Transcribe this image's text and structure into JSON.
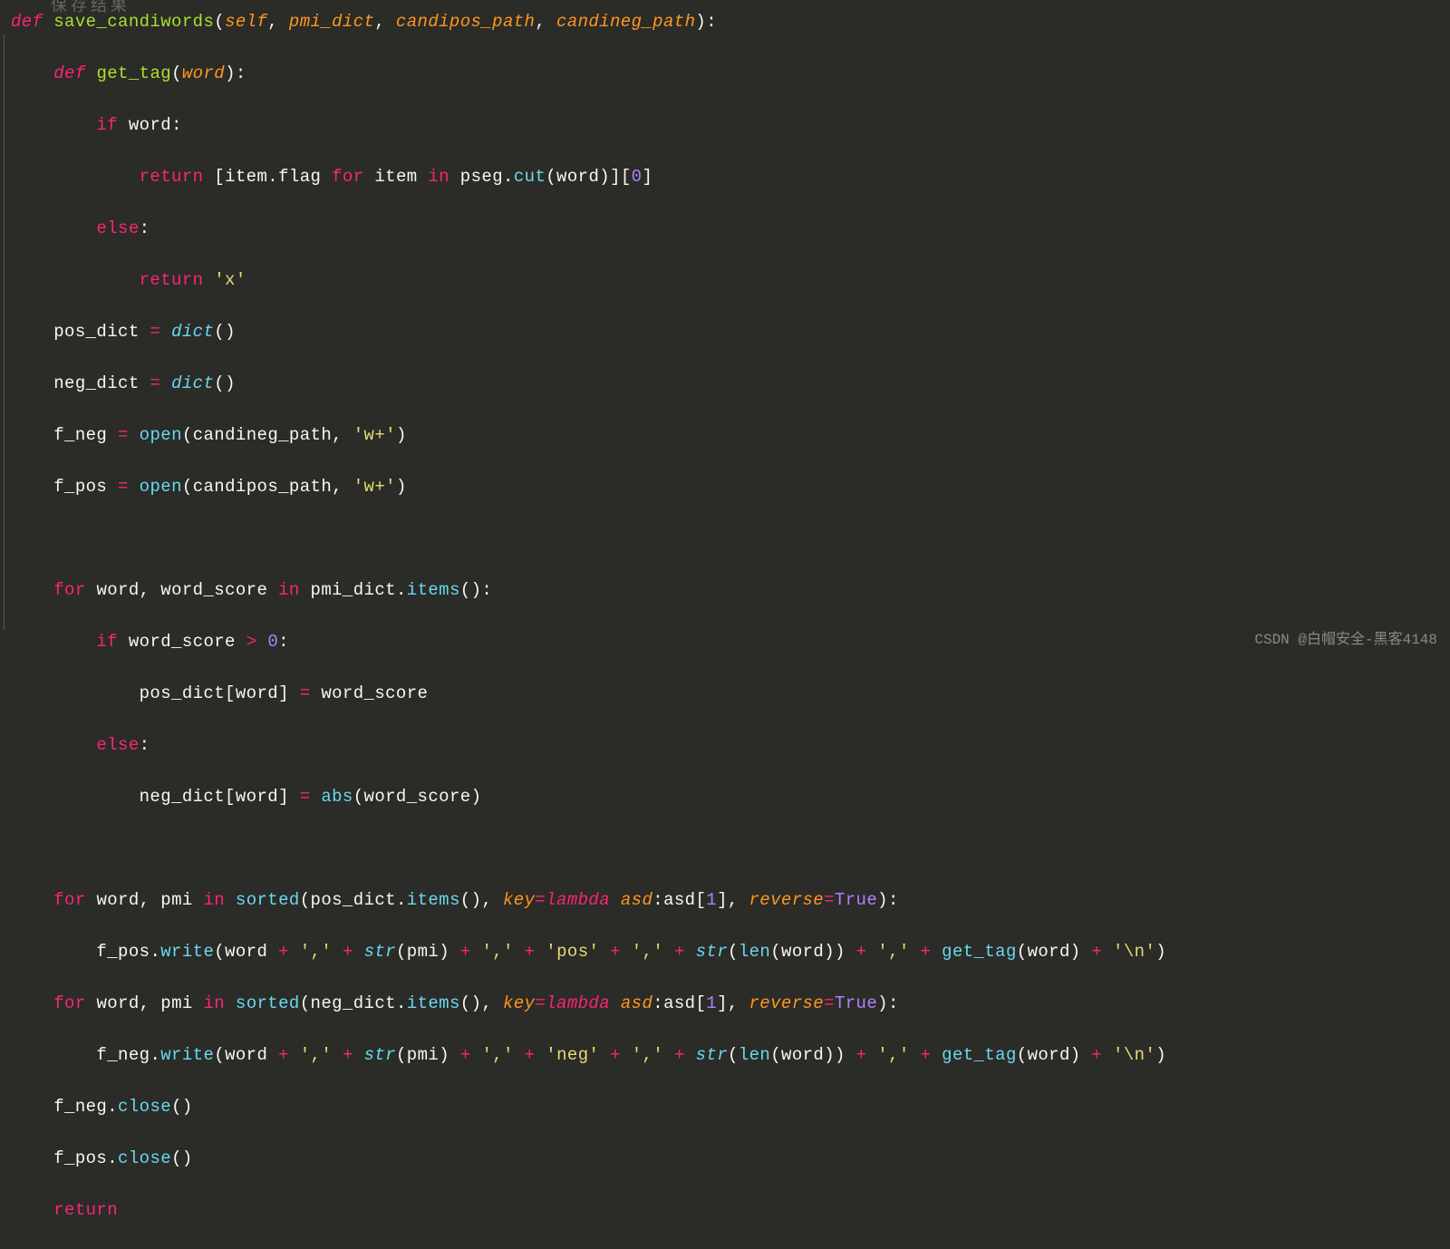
{
  "header_remnant": "保存结果",
  "code": {
    "def": "def",
    "save_candiwords": "save_candiwords",
    "self": "self",
    "pmi_dict": "pmi_dict",
    "candipos_path": "candipos_path",
    "candineg_path": "candineg_path",
    "get_tag": "get_tag",
    "word": "word",
    "if": "if",
    "return": "return",
    "item": "item",
    "flag": "flag",
    "for": "for",
    "in": "in",
    "pseg": "pseg",
    "cut": "cut",
    "zero": "0",
    "else": "else",
    "x_str": "'x'",
    "pos_dict": "pos_dict",
    "neg_dict": "neg_dict",
    "dict": "dict",
    "f_neg": "f_neg",
    "f_pos": "f_pos",
    "open": "open",
    "wplus": "'w+'",
    "word_score": "word_score",
    "items": "items",
    "gt": ">",
    "abs": "abs",
    "pmi": "pmi",
    "sorted": "sorted",
    "key": "key",
    "lambda": "lambda",
    "asd": "asd",
    "one": "1",
    "reverse": "reverse",
    "True": "True",
    "write": "write",
    "comma": "','",
    "str": "str",
    "pos_str": "'pos'",
    "neg_str": "'neg'",
    "len": "len",
    "newline": "'\\n'",
    "close": "close"
  },
  "watermark": "CSDN @白帽安全-黑客4148"
}
